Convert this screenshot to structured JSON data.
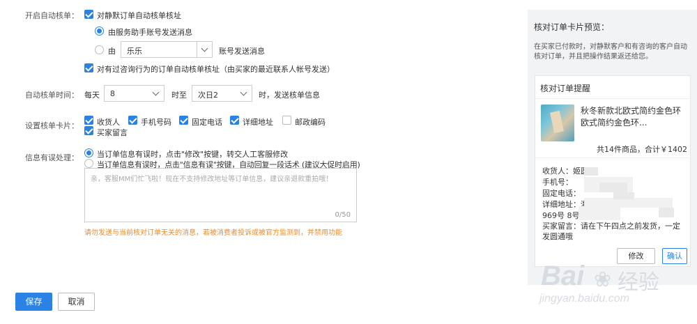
{
  "form": {
    "auto_verify": {
      "label": "开启自动核单：",
      "silent_orders": {
        "label": "对静默订单自动核单核址",
        "checked": true
      },
      "send_option_service": {
        "label": "由服务助手账号发送消息",
        "selected": true
      },
      "send_option_account": {
        "prefix": "由",
        "account_value": "乐乐",
        "suffix": "账号发送消息",
        "selected": false
      },
      "inquiry_orders": {
        "label": "对有过咨询行为的订单自动核单核址（由买家的最近联系人帐号发送）",
        "checked": true
      }
    },
    "time": {
      "label": "自动核单时间：",
      "prefix": "每天",
      "start_value": "8",
      "middle": "时至",
      "end_value": "次日2",
      "suffix": "时，发送核单信息"
    },
    "card_settings": {
      "label": "设置核单卡片：",
      "options": [
        {
          "label": "收货人",
          "checked": true
        },
        {
          "label": "手机号码",
          "checked": true
        },
        {
          "label": "固定电话",
          "checked": true
        },
        {
          "label": "详细地址",
          "checked": true
        },
        {
          "label": "邮政编码",
          "checked": false
        },
        {
          "label": "买家留言",
          "checked": true
        }
      ]
    },
    "error_handling": {
      "label": "信息有误处理：",
      "option_transfer": {
        "label": "当订单信息有误时，点击\"修改\"按键，转交人工客服修改",
        "selected": true
      },
      "option_reply": {
        "label": "当订单信息有误时，点击\"信息有误\"按键，自动回复一段话术 (建议大促时启用)",
        "selected": false
      },
      "textarea_placeholder": "亲，客服MM们忙飞啦！现在不支持修改地址等订单信息，建议亲退款重拍哦！",
      "char_count": "0/50",
      "warning": "请勿发送与当前核对订单无关的消息，若被消费者投诉或被官方监测到，并禁用功能"
    }
  },
  "buttons": {
    "save": "保存",
    "cancel": "取消"
  },
  "preview": {
    "title": "核对订单卡片预览：",
    "description": "在买家已付款时，对静默客户和有咨询的客户自动核对订单，并且把操作结果返还给您。",
    "card": {
      "header": "核对订单提醒",
      "product_name": "秋冬新款北欧式简约金色环欧式简约金色环...",
      "summary": "共14件商品，合计￥1402",
      "recipient": "收货人：姬圆",
      "mobile": "手机号：",
      "landline": "固定电话：",
      "address_label": "详细地址：浙",
      "address_line2": "969号 8号楼",
      "buyer_message": "买家留言：请在下午四点之前发货，一定发圆通哦",
      "modify_button": "修改",
      "confirm_button": "确认"
    }
  },
  "watermark": {
    "brand": "Bai",
    "brand_cn": "经验",
    "url": "jingyan.baidu.com"
  },
  "colors": {
    "accent": "#2a82e4",
    "warning": "#f08a24",
    "panel_bg": "#f2f3f5"
  }
}
